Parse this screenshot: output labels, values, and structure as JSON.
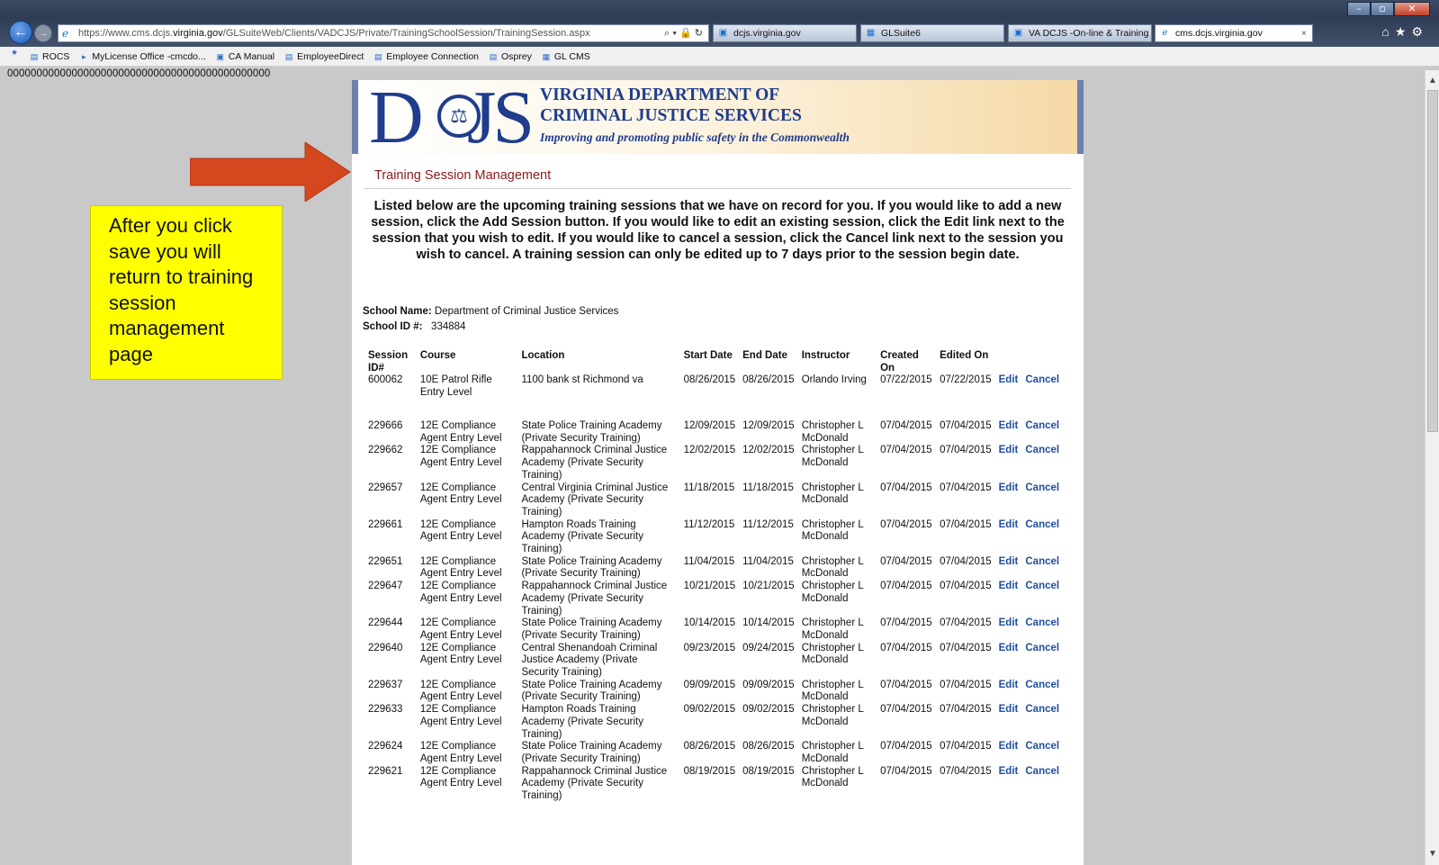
{
  "browser": {
    "url_prefix": "https://www.cms.dcjs.",
    "url_host": "virginia.gov",
    "url_path": "/GLSuiteWeb/Clients/VADCJS/Private/TrainingSchoolSession/TrainingSession.aspx",
    "address_tools": "⌕ ▾ 🔒 ↻",
    "tabs": [
      {
        "label": "dcjs.virginia.gov"
      },
      {
        "label": "GLSuite6"
      },
      {
        "label": "VA DCJS -On-line & Training A..."
      },
      {
        "label": "cms.dcjs.virginia.gov"
      }
    ],
    "tab_close": "×",
    "favorites": [
      "ROCS",
      "MyLicense Office -cmcdo...",
      "CA Manual",
      "EmployeeDirect",
      "Employee Connection",
      "Osprey",
      "GL CMS"
    ],
    "zeros_text": "000000000000000000000000000000000000000000000"
  },
  "annotation": {
    "callout_text": "After you click save you will return to training session management page"
  },
  "header": {
    "logo_text": "DCJS",
    "agency_line1": "VIRGINIA DEPARTMENT OF",
    "agency_line2": "CRIMINAL JUSTICE SERVICES",
    "tagline": "Improving and promoting public safety in the Commonwealth"
  },
  "page": {
    "title": "Training Session Management",
    "intro": "Listed below are the upcoming training sessions that we have on record for you. If you would like to add a new session, click the Add Session button. If you would like to edit an existing session, click the Edit link next to the session that you wish to edit. If you would like to cancel a session, click the Cancel link next to the session you wish to cancel. A training session can only be edited up to 7 days prior to the session begin date.",
    "school_name_label": "School Name:",
    "school_name": "Department of Criminal Justice Services",
    "school_id_label": "School ID #:",
    "school_id": "334884"
  },
  "table": {
    "headers": [
      "Session ID#",
      "Course",
      "Location",
      "Start Date",
      "End Date",
      "Instructor",
      "Created On",
      "Edited On"
    ],
    "edit_label": "Edit",
    "cancel_label": "Cancel",
    "rows": [
      {
        "id": "600062",
        "course": "10E Patrol Rifle Entry Level",
        "location": "1100 bank st Richmond va",
        "start": "08/26/2015",
        "end": "08/26/2015",
        "instructor": "Orlando Irving",
        "created": "07/22/2015",
        "edited": "07/22/2015"
      },
      {
        "id": "229666",
        "course": "12E Compliance Agent Entry Level",
        "location": "State Police Training Academy (Private Security Training)",
        "start": "12/09/2015",
        "end": "12/09/2015",
        "instructor": "Christopher L McDonald",
        "created": "07/04/2015",
        "edited": "07/04/2015"
      },
      {
        "id": "229662",
        "course": "12E Compliance Agent Entry Level",
        "location": "Rappahannock Criminal Justice Academy (Private Security Training)",
        "start": "12/02/2015",
        "end": "12/02/2015",
        "instructor": "Christopher L McDonald",
        "created": "07/04/2015",
        "edited": "07/04/2015"
      },
      {
        "id": "229657",
        "course": "12E Compliance Agent Entry Level",
        "location": "Central Virginia Criminal Justice Academy (Private Security Training)",
        "start": "11/18/2015",
        "end": "11/18/2015",
        "instructor": "Christopher L McDonald",
        "created": "07/04/2015",
        "edited": "07/04/2015"
      },
      {
        "id": "229661",
        "course": "12E Compliance Agent Entry Level",
        "location": "Hampton Roads Training Academy (Private Security Training)",
        "start": "11/12/2015",
        "end": "11/12/2015",
        "instructor": "Christopher L McDonald",
        "created": "07/04/2015",
        "edited": "07/04/2015"
      },
      {
        "id": "229651",
        "course": "12E Compliance Agent Entry Level",
        "location": "State Police Training Academy (Private Security Training)",
        "start": "11/04/2015",
        "end": "11/04/2015",
        "instructor": "Christopher L McDonald",
        "created": "07/04/2015",
        "edited": "07/04/2015"
      },
      {
        "id": "229647",
        "course": "12E Compliance Agent Entry Level",
        "location": "Rappahannock Criminal Justice Academy (Private Security Training)",
        "start": "10/21/2015",
        "end": "10/21/2015",
        "instructor": "Christopher L McDonald",
        "created": "07/04/2015",
        "edited": "07/04/2015"
      },
      {
        "id": "229644",
        "course": "12E Compliance Agent Entry Level",
        "location": "State Police Training Academy (Private Security Training)",
        "start": "10/14/2015",
        "end": "10/14/2015",
        "instructor": "Christopher L McDonald",
        "created": "07/04/2015",
        "edited": "07/04/2015"
      },
      {
        "id": "229640",
        "course": "12E Compliance Agent Entry Level",
        "location": "Central Shenandoah Criminal Justice Academy (Private Security Training)",
        "start": "09/23/2015",
        "end": "09/24/2015",
        "instructor": "Christopher L McDonald",
        "created": "07/04/2015",
        "edited": "07/04/2015"
      },
      {
        "id": "229637",
        "course": "12E Compliance Agent Entry Level",
        "location": "State Police Training Academy (Private Security Training)",
        "start": "09/09/2015",
        "end": "09/09/2015",
        "instructor": "Christopher L McDonald",
        "created": "07/04/2015",
        "edited": "07/04/2015"
      },
      {
        "id": "229633",
        "course": "12E Compliance Agent Entry Level",
        "location": "Hampton Roads Training Academy (Private Security Training)",
        "start": "09/02/2015",
        "end": "09/02/2015",
        "instructor": "Christopher L McDonald",
        "created": "07/04/2015",
        "edited": "07/04/2015"
      },
      {
        "id": "229624",
        "course": "12E Compliance Agent Entry Level",
        "location": "State Police Training Academy (Private Security Training)",
        "start": "08/26/2015",
        "end": "08/26/2015",
        "instructor": "Christopher L McDonald",
        "created": "07/04/2015",
        "edited": "07/04/2015"
      },
      {
        "id": "229621",
        "course": "12E Compliance Agent Entry Level",
        "location": "Rappahannock Criminal Justice Academy (Private Security Training)",
        "start": "08/19/2015",
        "end": "08/19/2015",
        "instructor": "Christopher L McDonald",
        "created": "07/04/2015",
        "edited": "07/04/2015"
      }
    ]
  },
  "colors": {
    "title_red": "#8b1a1a",
    "link_blue": "#1f4fa0",
    "callout_yellow": "#ffff00",
    "arrow_orange": "#d4471f",
    "brand_blue": "#1f3d8c"
  },
  "icons": {
    "back": "back-arrow-icon",
    "forward": "forward-arrow-icon",
    "browser": "internet-explorer-icon",
    "home": "home-icon",
    "favorites": "star-icon",
    "settings": "gear-icon"
  }
}
